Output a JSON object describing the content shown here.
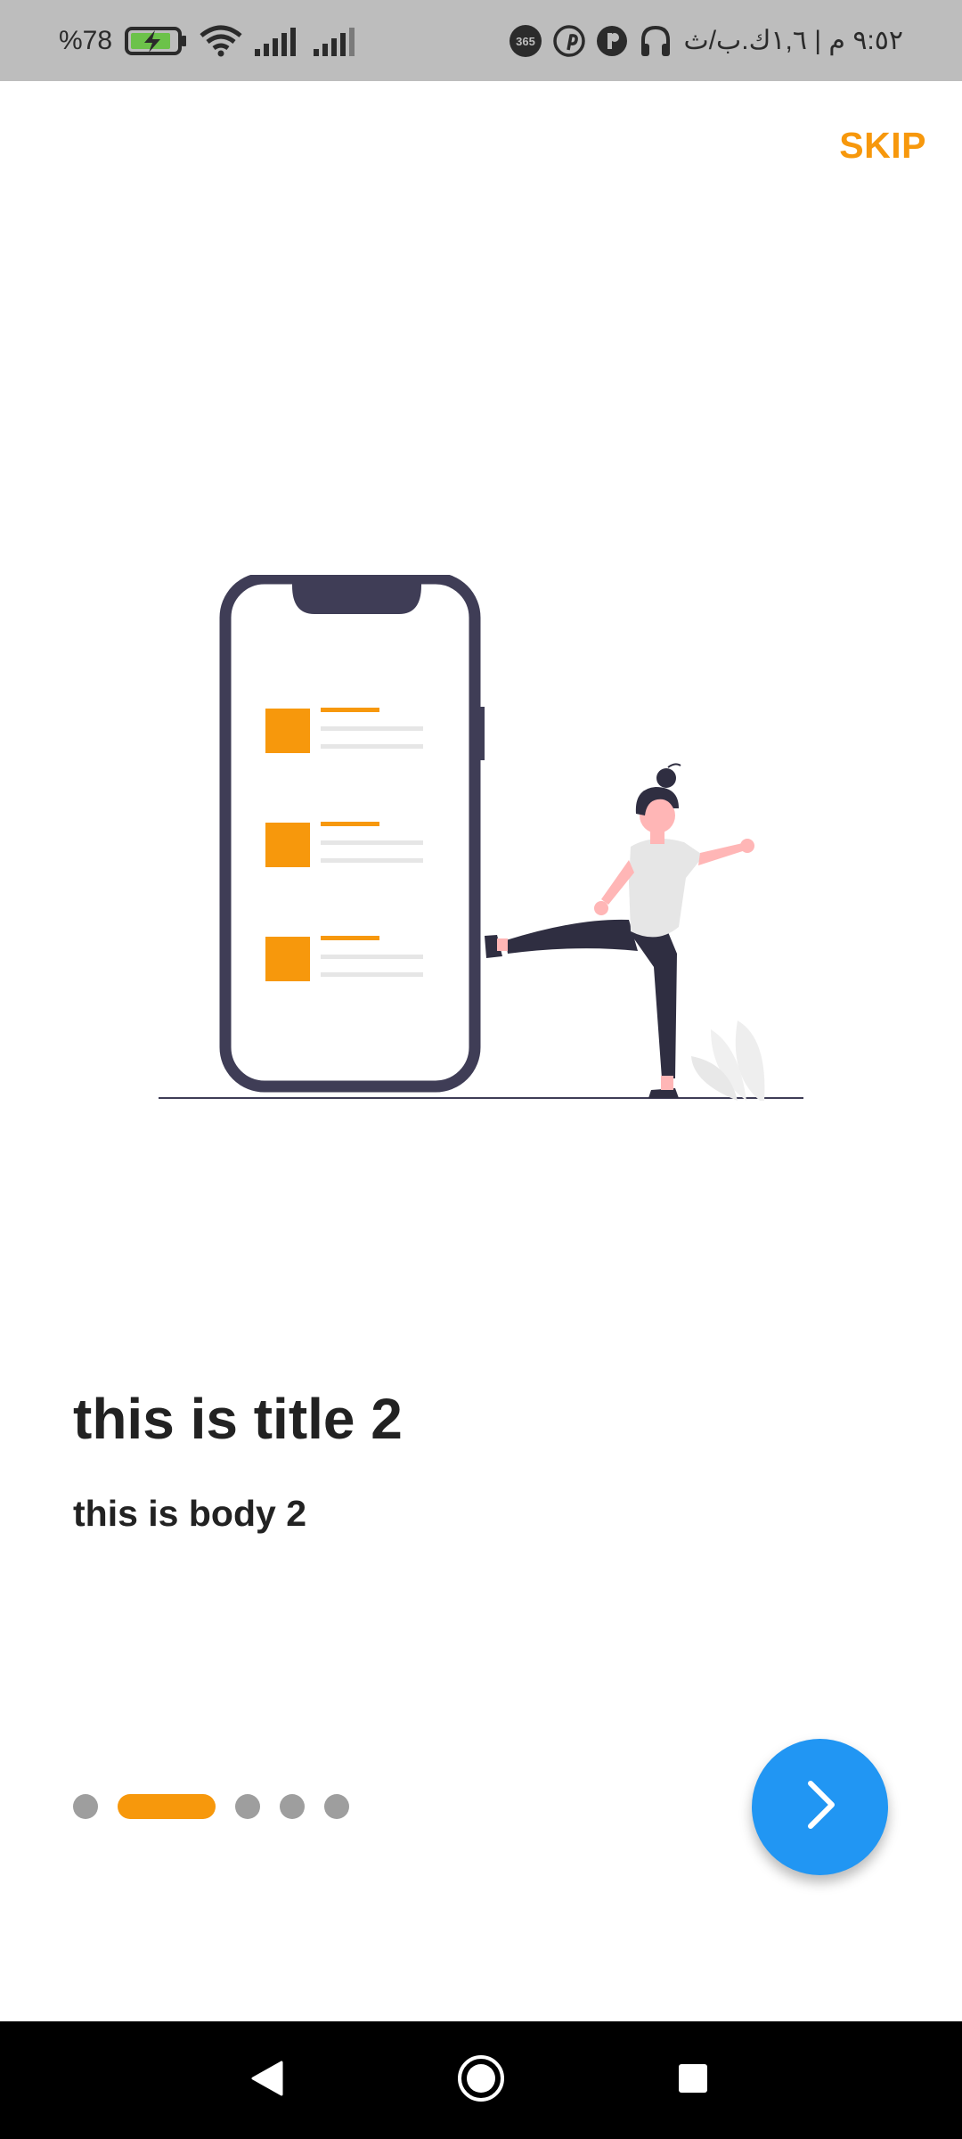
{
  "status_bar": {
    "battery_level": "%78",
    "time": "٩:٥٢ م | ١,٦ك.ب/ث",
    "icons": [
      "battery-charging-icon",
      "wifi-icon",
      "signal-icon",
      "signal-icon",
      "app-365-icon",
      "pinterest-icon",
      "app-icon",
      "headphones-icon"
    ]
  },
  "header": {
    "skip_label": "SKIP"
  },
  "onboarding": {
    "title": "this is title 2",
    "body": "this is body 2",
    "page_indicator": {
      "total": 5,
      "current": 2
    }
  },
  "fab": {
    "icon": "chevron-right-icon"
  },
  "nav_bar": {
    "buttons": [
      "back-icon",
      "home-icon",
      "recents-icon"
    ]
  },
  "colors": {
    "accent": "#f7980c",
    "fab": "#2196f3",
    "text": "#222222",
    "inactive_dot": "#9e9e9e",
    "status_bar": "#bdbdbd"
  }
}
